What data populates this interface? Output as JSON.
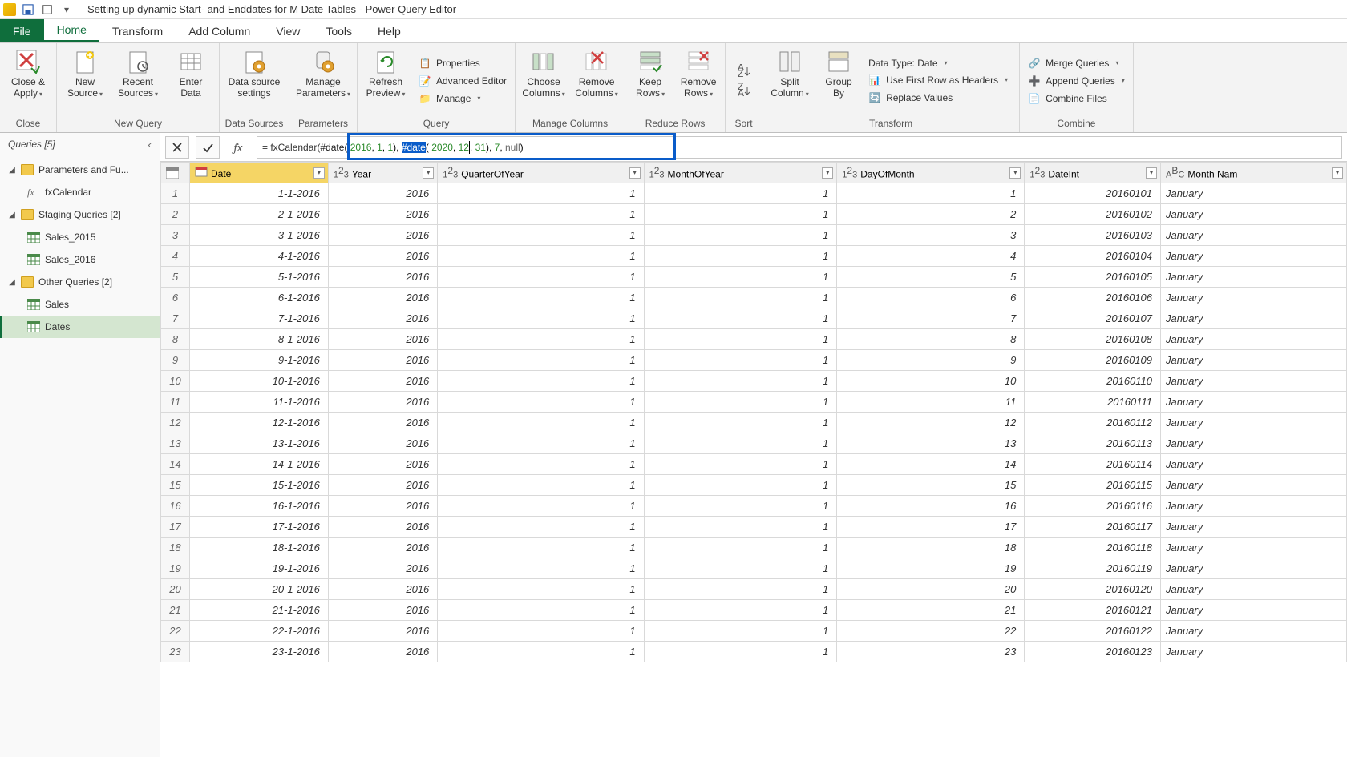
{
  "window": {
    "title": "Setting up dynamic Start- and Enddates for M Date Tables - Power Query Editor"
  },
  "tabs": {
    "file": "File",
    "home": "Home",
    "transform": "Transform",
    "addcol": "Add Column",
    "view": "View",
    "tools": "Tools",
    "help": "Help"
  },
  "ribbon": {
    "close": {
      "btn": "Close &\nApply",
      "group": "Close"
    },
    "newquery": {
      "newsrc": "New\nSource",
      "recent": "Recent\nSources",
      "enter": "Enter\nData",
      "group": "New Query"
    },
    "datasources": {
      "btn": "Data source\nsettings",
      "group": "Data Sources"
    },
    "parameters": {
      "btn": "Manage\nParameters",
      "group": "Parameters"
    },
    "query": {
      "refresh": "Refresh\nPreview",
      "properties": "Properties",
      "adv": "Advanced Editor",
      "manage": "Manage",
      "group": "Query"
    },
    "managecols": {
      "choose": "Choose\nColumns",
      "remove": "Remove\nColumns",
      "group": "Manage Columns"
    },
    "reducerows": {
      "keep": "Keep\nRows",
      "remove": "Remove\nRows",
      "group": "Reduce Rows"
    },
    "sort": {
      "group": "Sort"
    },
    "transform": {
      "split": "Split\nColumn",
      "group": "Group\nBy",
      "datatype": "Data Type: Date",
      "firstrow": "Use First Row as Headers",
      "replace": "Replace Values",
      "glabel": "Transform"
    },
    "combine": {
      "merge": "Merge Queries",
      "append": "Append Queries",
      "combine": "Combine Files",
      "group": "Combine"
    }
  },
  "queriesPane": {
    "title": "Queries [5]",
    "groups": [
      {
        "label": "Parameters and Fu...",
        "children": [
          {
            "label": "fxCalendar",
            "type": "fx"
          }
        ]
      },
      {
        "label": "Staging Queries [2]",
        "children": [
          {
            "label": "Sales_2015",
            "type": "tbl"
          },
          {
            "label": "Sales_2016",
            "type": "tbl"
          }
        ]
      },
      {
        "label": "Other Queries [2]",
        "children": [
          {
            "label": "Sales",
            "type": "tbl"
          },
          {
            "label": "Dates",
            "type": "tbl",
            "selected": true
          }
        ]
      }
    ]
  },
  "formula": {
    "prefix": "= fxCalendar(",
    "seg1": "#date(",
    "n1": " 2016",
    "c1": ", ",
    "n2": "1",
    "c2": ", ",
    "n3": "1",
    "seg1e": "), ",
    "seg2a": "#date",
    "seg2b": "(",
    "n4": " 2020",
    "c3": ", ",
    "n5": "12",
    "c4": ", ",
    "n6": "31",
    "seg2e": "), ",
    "n7": "7",
    "c5": ", ",
    "nul": "null",
    "end": ")"
  },
  "columns": [
    {
      "name": "Date",
      "type": "date",
      "selected": true
    },
    {
      "name": "Year",
      "type": "num"
    },
    {
      "name": "QuarterOfYear",
      "type": "num"
    },
    {
      "name": "MonthOfYear",
      "type": "num"
    },
    {
      "name": "DayOfMonth",
      "type": "num"
    },
    {
      "name": "DateInt",
      "type": "num"
    },
    {
      "name": "Month Nam",
      "type": "txt"
    }
  ],
  "rows": [
    {
      "n": 1,
      "date": "1-1-2016",
      "year": 2016,
      "q": 1,
      "m": 1,
      "d": 1,
      "di": 20160101,
      "mn": "January"
    },
    {
      "n": 2,
      "date": "2-1-2016",
      "year": 2016,
      "q": 1,
      "m": 1,
      "d": 2,
      "di": 20160102,
      "mn": "January"
    },
    {
      "n": 3,
      "date": "3-1-2016",
      "year": 2016,
      "q": 1,
      "m": 1,
      "d": 3,
      "di": 20160103,
      "mn": "January"
    },
    {
      "n": 4,
      "date": "4-1-2016",
      "year": 2016,
      "q": 1,
      "m": 1,
      "d": 4,
      "di": 20160104,
      "mn": "January"
    },
    {
      "n": 5,
      "date": "5-1-2016",
      "year": 2016,
      "q": 1,
      "m": 1,
      "d": 5,
      "di": 20160105,
      "mn": "January"
    },
    {
      "n": 6,
      "date": "6-1-2016",
      "year": 2016,
      "q": 1,
      "m": 1,
      "d": 6,
      "di": 20160106,
      "mn": "January"
    },
    {
      "n": 7,
      "date": "7-1-2016",
      "year": 2016,
      "q": 1,
      "m": 1,
      "d": 7,
      "di": 20160107,
      "mn": "January"
    },
    {
      "n": 8,
      "date": "8-1-2016",
      "year": 2016,
      "q": 1,
      "m": 1,
      "d": 8,
      "di": 20160108,
      "mn": "January"
    },
    {
      "n": 9,
      "date": "9-1-2016",
      "year": 2016,
      "q": 1,
      "m": 1,
      "d": 9,
      "di": 20160109,
      "mn": "January"
    },
    {
      "n": 10,
      "date": "10-1-2016",
      "year": 2016,
      "q": 1,
      "m": 1,
      "d": 10,
      "di": 20160110,
      "mn": "January"
    },
    {
      "n": 11,
      "date": "11-1-2016",
      "year": 2016,
      "q": 1,
      "m": 1,
      "d": 11,
      "di": 20160111,
      "mn": "January"
    },
    {
      "n": 12,
      "date": "12-1-2016",
      "year": 2016,
      "q": 1,
      "m": 1,
      "d": 12,
      "di": 20160112,
      "mn": "January"
    },
    {
      "n": 13,
      "date": "13-1-2016",
      "year": 2016,
      "q": 1,
      "m": 1,
      "d": 13,
      "di": 20160113,
      "mn": "January"
    },
    {
      "n": 14,
      "date": "14-1-2016",
      "year": 2016,
      "q": 1,
      "m": 1,
      "d": 14,
      "di": 20160114,
      "mn": "January"
    },
    {
      "n": 15,
      "date": "15-1-2016",
      "year": 2016,
      "q": 1,
      "m": 1,
      "d": 15,
      "di": 20160115,
      "mn": "January"
    },
    {
      "n": 16,
      "date": "16-1-2016",
      "year": 2016,
      "q": 1,
      "m": 1,
      "d": 16,
      "di": 20160116,
      "mn": "January"
    },
    {
      "n": 17,
      "date": "17-1-2016",
      "year": 2016,
      "q": 1,
      "m": 1,
      "d": 17,
      "di": 20160117,
      "mn": "January"
    },
    {
      "n": 18,
      "date": "18-1-2016",
      "year": 2016,
      "q": 1,
      "m": 1,
      "d": 18,
      "di": 20160118,
      "mn": "January"
    },
    {
      "n": 19,
      "date": "19-1-2016",
      "year": 2016,
      "q": 1,
      "m": 1,
      "d": 19,
      "di": 20160119,
      "mn": "January"
    },
    {
      "n": 20,
      "date": "20-1-2016",
      "year": 2016,
      "q": 1,
      "m": 1,
      "d": 20,
      "di": 20160120,
      "mn": "January"
    },
    {
      "n": 21,
      "date": "21-1-2016",
      "year": 2016,
      "q": 1,
      "m": 1,
      "d": 21,
      "di": 20160121,
      "mn": "January"
    },
    {
      "n": 22,
      "date": "22-1-2016",
      "year": 2016,
      "q": 1,
      "m": 1,
      "d": 22,
      "di": 20160122,
      "mn": "January"
    },
    {
      "n": 23,
      "date": "23-1-2016",
      "year": 2016,
      "q": 1,
      "m": 1,
      "d": 23,
      "di": 20160123,
      "mn": "January"
    }
  ]
}
